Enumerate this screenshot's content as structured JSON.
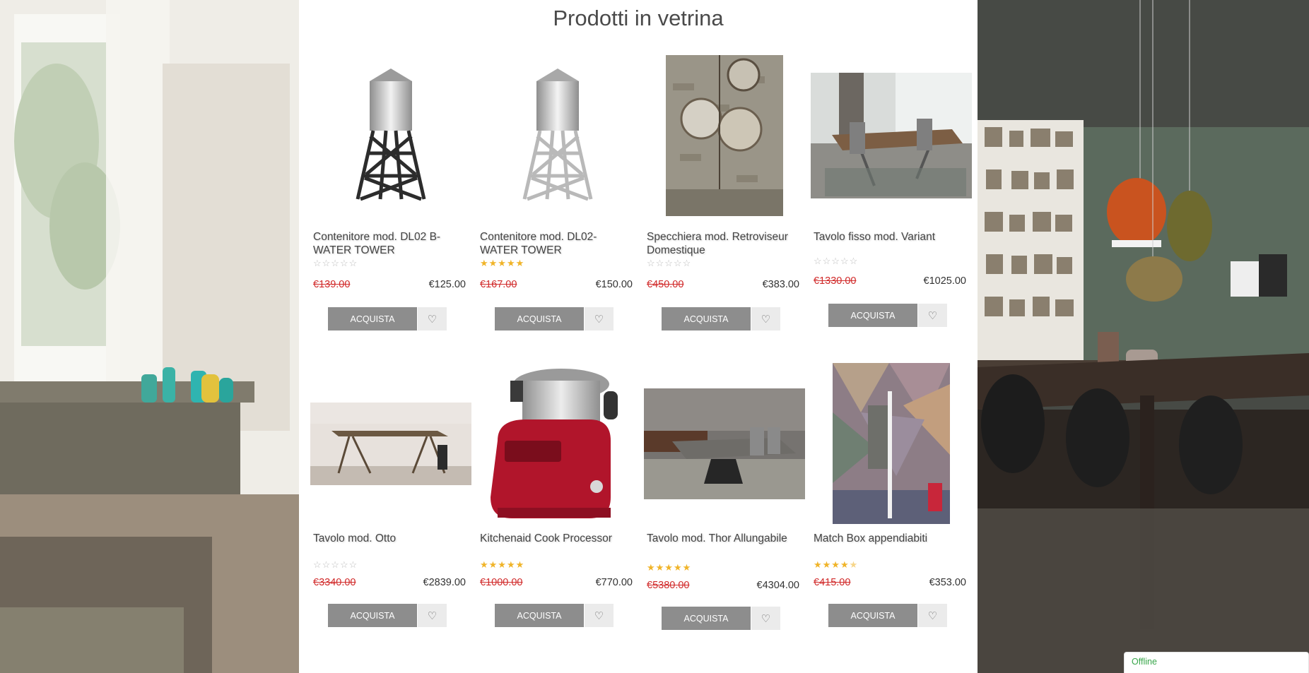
{
  "page_title": "Prodotti in vetrina",
  "buy_label": "ACQUISTA",
  "chat_status": "Offline",
  "products": [
    {
      "name": "Contenitore mod. DL02 B-WATER TOWER",
      "old_price": "€139.00",
      "price": "€125.00",
      "rating": 0,
      "image": "water-tower-black"
    },
    {
      "name": "Contenitore mod. DL02-WATER TOWER",
      "old_price": "€167.00",
      "price": "€150.00",
      "rating": 5,
      "image": "water-tower-silver"
    },
    {
      "name": "Specchiera mod. Retroviseur Domestique",
      "old_price": "€450.00",
      "price": "€383.00",
      "rating": 0,
      "image": "mirrors"
    },
    {
      "name": "Tavolo fisso mod. Variant",
      "old_price": "€1330.00",
      "price": "€1025.00",
      "rating": 0,
      "image": "dining-table-variant"
    },
    {
      "name": "Tavolo mod. Otto",
      "old_price": "€3340.00",
      "price": "€2839.00",
      "rating": 0,
      "image": "table-otto"
    },
    {
      "name": "Kitchenaid Cook Processor",
      "old_price": "€1000.00",
      "price": "€770.00",
      "rating": 5,
      "image": "kitchenaid"
    },
    {
      "name": "Tavolo mod. Thor Allungabile",
      "old_price": "€5380.00",
      "price": "€4304.00",
      "rating": 5,
      "image": "table-thor"
    },
    {
      "name": "Match Box appendiabiti",
      "old_price": "€415.00",
      "price": "€353.00",
      "rating": 4.5,
      "image": "coat-rack"
    }
  ],
  "colors": {
    "old_price": "#d12a2a",
    "star": "#f0b429",
    "buy_button": "#8d8d8d",
    "chat_status": "#38a64a"
  }
}
